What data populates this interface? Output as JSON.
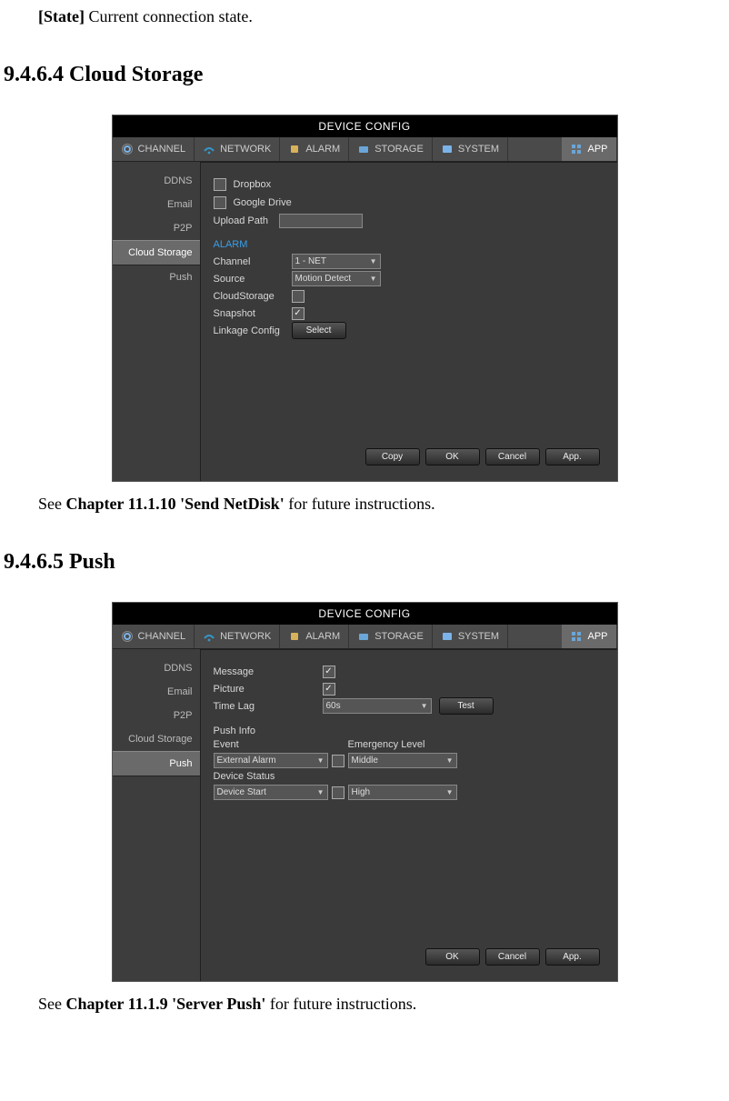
{
  "stateLine": {
    "label": "[State]",
    "text": " Current connection state."
  },
  "section1": {
    "title": "9.4.6.4 Cloud Storage"
  },
  "panel": {
    "title": "DEVICE CONFIG",
    "tabs": {
      "channel": "CHANNEL",
      "network": "NETWORK",
      "alarm": "ALARM",
      "storage": "STORAGE",
      "system": "SYSTEM",
      "app": "APP"
    },
    "sidebar": {
      "ddns": "DDNS",
      "email": "Email",
      "p2p": "P2P",
      "cloud": "Cloud Storage",
      "push": "Push"
    },
    "buttons": {
      "copy": "Copy",
      "ok": "OK",
      "cancel": "Cancel",
      "app": "App.",
      "select": "Select",
      "test": "Test"
    }
  },
  "cloud": {
    "dropbox": "Dropbox",
    "google": "Google Drive",
    "uploadPath": "Upload Path",
    "alarm": "ALARM",
    "channel": "Channel",
    "channelVal": "1 - NET",
    "source": "Source",
    "sourceVal": "Motion Detect",
    "cloudstorage": "CloudStorage",
    "snapshot": "Snapshot",
    "linkage": "Linkage Config"
  },
  "caption1": {
    "pre": "See ",
    "bold": "Chapter 11.1.10 'Send NetDisk'",
    "post": " for future instructions."
  },
  "section2": {
    "title": "9.4.6.5 Push"
  },
  "push": {
    "message": "Message",
    "picture": "Picture",
    "timelag": "Time Lag",
    "timelagVal": "60s",
    "pushinfo": "Push Info",
    "event": "Event",
    "emergency": "Emergency Level",
    "eventVal": "External Alarm",
    "eventLvl": "Middle",
    "devstatus": "Device Status",
    "devstatusVal": "Device Start",
    "devstatusLvl": "High"
  },
  "caption2": {
    "pre": "See ",
    "bold": "Chapter 11.1.9 'Server Push'",
    "post": " for future instructions."
  }
}
